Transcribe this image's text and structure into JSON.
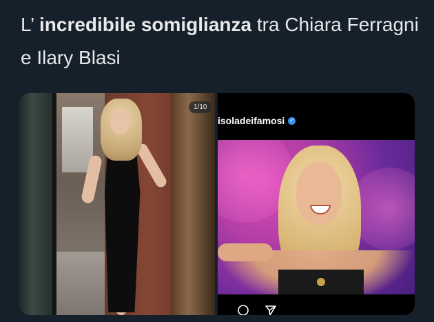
{
  "tweet": {
    "prefix": "L’ ",
    "bold": "incredibile somiglianza",
    "suffix": " tra Chiara Ferragni e Ilary Blasi"
  },
  "media": {
    "left": {
      "page_counter": "1/10"
    },
    "right": {
      "account_name": "isoladeifamosi"
    }
  },
  "colors": {
    "background": "#15202b",
    "text": "#e7e9ea",
    "verified": "#3897f0"
  },
  "icons": [
    "verified-icon",
    "comment-icon",
    "share-icon"
  ]
}
